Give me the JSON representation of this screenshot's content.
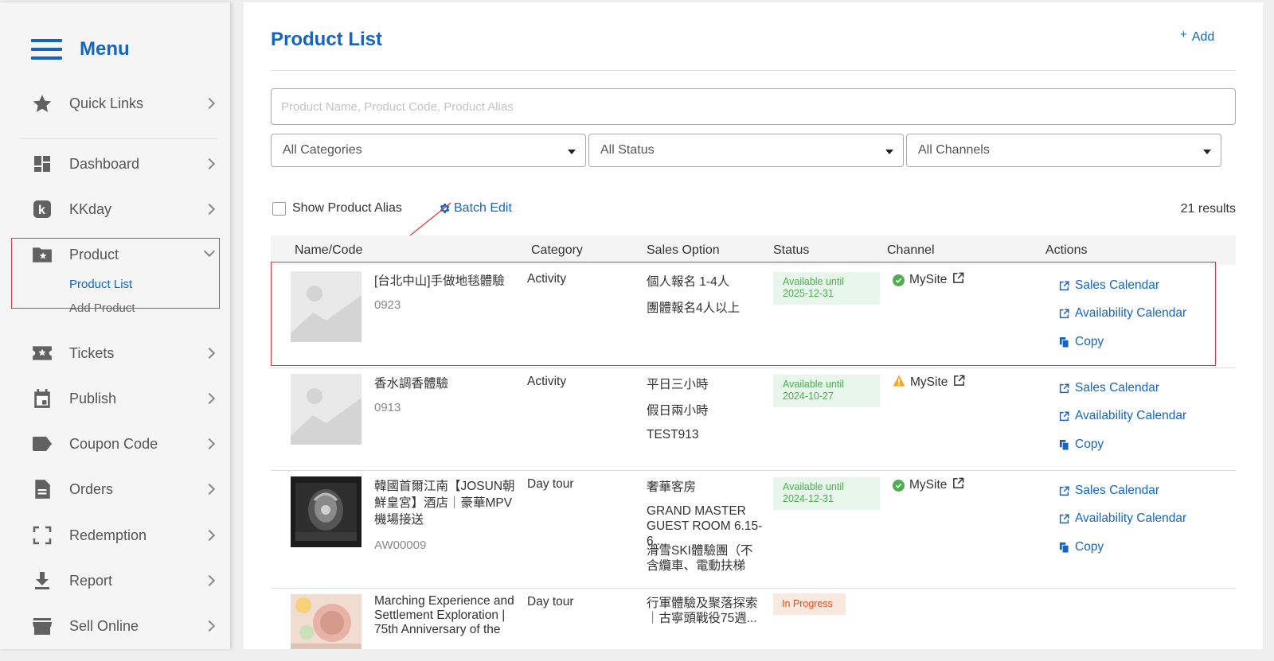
{
  "sidebar": {
    "title": "Menu",
    "items": [
      {
        "label": "Quick Links",
        "icon": "star-icon"
      },
      {
        "label": "Dashboard",
        "icon": "dashboard-icon"
      },
      {
        "label": "KKday",
        "icon": "kkday-logo-icon"
      },
      {
        "label": "Product",
        "icon": "folder-star-icon",
        "expanded": true
      },
      {
        "label": "Tickets",
        "icon": "ticket-icon"
      },
      {
        "label": "Publish",
        "icon": "calendar-icon"
      },
      {
        "label": "Coupon Code",
        "icon": "tag-icon"
      },
      {
        "label": "Orders",
        "icon": "document-icon"
      },
      {
        "label": "Redemption",
        "icon": "scan-frame-icon"
      },
      {
        "label": "Report",
        "icon": "download-icon"
      },
      {
        "label": "Sell Online",
        "icon": "store-icon"
      }
    ],
    "product_sub": {
      "active": "Product List",
      "other": "Add Product"
    },
    "kkday_letter": "k"
  },
  "main": {
    "title": "Product List",
    "add_label": "Add",
    "search_placeholder": "Product Name, Product Code, Product Alias",
    "filters": [
      "All Categories",
      "All Status",
      "All Channels"
    ],
    "show_alias_label": "Show Product Alias",
    "show_alias_checked": false,
    "batch_edit_label": "Batch Edit",
    "results": "21 results",
    "columns": [
      "Name/Code",
      "Category",
      "Sales Option",
      "Status",
      "Channel",
      "Actions"
    ],
    "actions": [
      "Sales Calendar",
      "Availability Calendar",
      "Copy"
    ],
    "products": [
      {
        "name": "[台北中山]手做地毯體驗",
        "code": "0923",
        "category": "Activity",
        "options": [
          "個人報名 1-4人",
          "團體報名4人以上"
        ],
        "status_line1": "Available until",
        "status_line2": "2025-12-31",
        "channel": "MySite",
        "channel_state": "ok",
        "thumb": "placeholder-image"
      },
      {
        "name": "香水調香體驗",
        "code": "0913",
        "category": "Activity",
        "options": [
          "平日三小時",
          "假日兩小時",
          "TEST913"
        ],
        "status_line1": "Available until",
        "status_line2": "2024-10-27",
        "channel": "MySite",
        "channel_state": "warning",
        "thumb": "placeholder-image"
      },
      {
        "name": "韓國首爾江南【JOSUN朝鮮皇宮】酒店｜豪華MPV機場接送",
        "code": "AW00009",
        "category": "Day tour",
        "options": [
          "奢華客房",
          "GRAND MASTER GUEST ROOM 6.15-6....",
          "滑雪SKI體驗團（不含纜車、電動扶梯"
        ],
        "status_line1": "Available until",
        "status_line2": "2024-12-31",
        "channel": "MySite",
        "channel_state": "ok",
        "thumb": "photo-dark"
      },
      {
        "name": "Marching Experience and Settlement Exploration | 75th Anniversary of the",
        "code": "",
        "category": "Day tour",
        "options": [
          "行軍體驗及聚落探索｜古寧頭戰役75週..."
        ],
        "status_line1": "In Progress",
        "status_line2": "",
        "channel": "",
        "channel_state": "none",
        "thumb": "photo-food"
      }
    ]
  },
  "colors": {
    "accent": "#1565c0",
    "available_bg": "#e8f5ea",
    "available_text": "#4caf50",
    "progress_bg": "#fbe9e0",
    "progress_text": "#e64a19",
    "highlight": "#e53935",
    "warning": "#f9a825"
  }
}
